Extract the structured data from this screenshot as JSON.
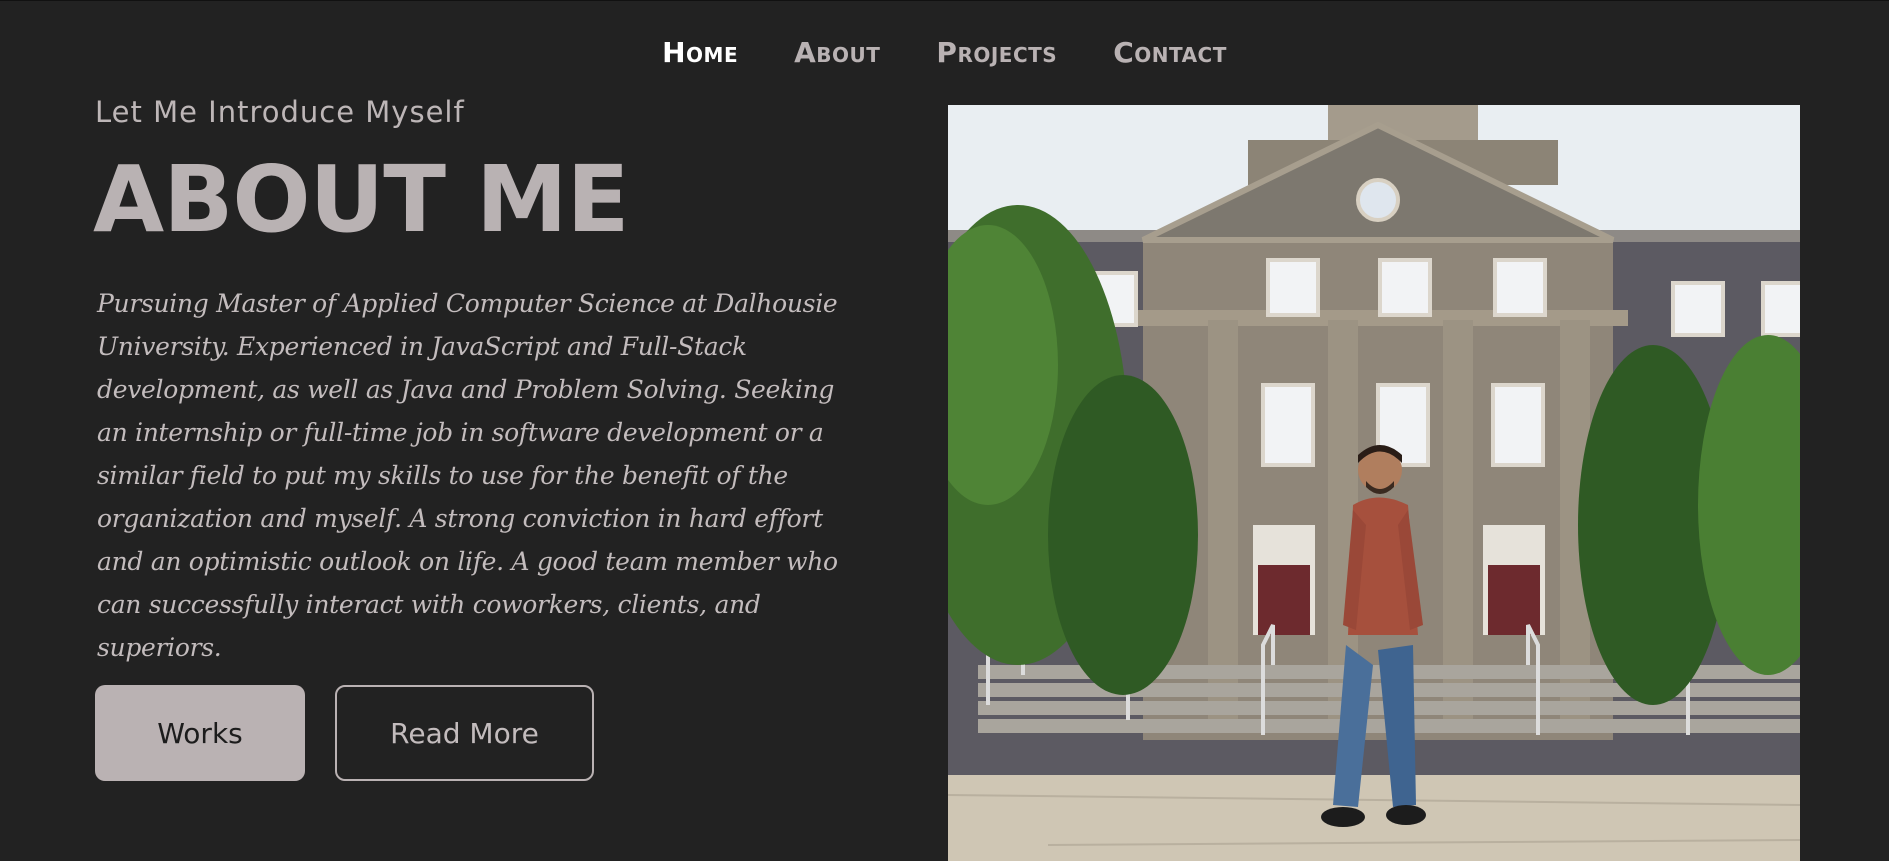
{
  "nav": {
    "items": [
      {
        "label": "Home",
        "active": true
      },
      {
        "label": "About",
        "active": false
      },
      {
        "label": "Projects",
        "active": false
      },
      {
        "label": "Contact",
        "active": false
      }
    ]
  },
  "hero": {
    "intro": "Let Me Introduce Myself",
    "title": "ABOUT ME",
    "bio": "Pursuing Master of Applied Computer Science at Dalhousie University. Experienced in JavaScript and Full-Stack development, as well as Java and Problem Solving. Seeking an internship or full-time job in software development or a similar field to put my skills to use for the benefit of the organization and myself. A strong conviction in hard effort and an optimistic outlook on life. A good team member who can successfully interact with coworkers, clients, and superiors.",
    "buttons": {
      "works": "Works",
      "read_more": "Read More"
    }
  },
  "photo": {
    "subject": "person-in-front-of-university-building"
  },
  "colors": {
    "background": "#222222",
    "accent": "#bab2b3",
    "nav_active": "#ffffff"
  }
}
